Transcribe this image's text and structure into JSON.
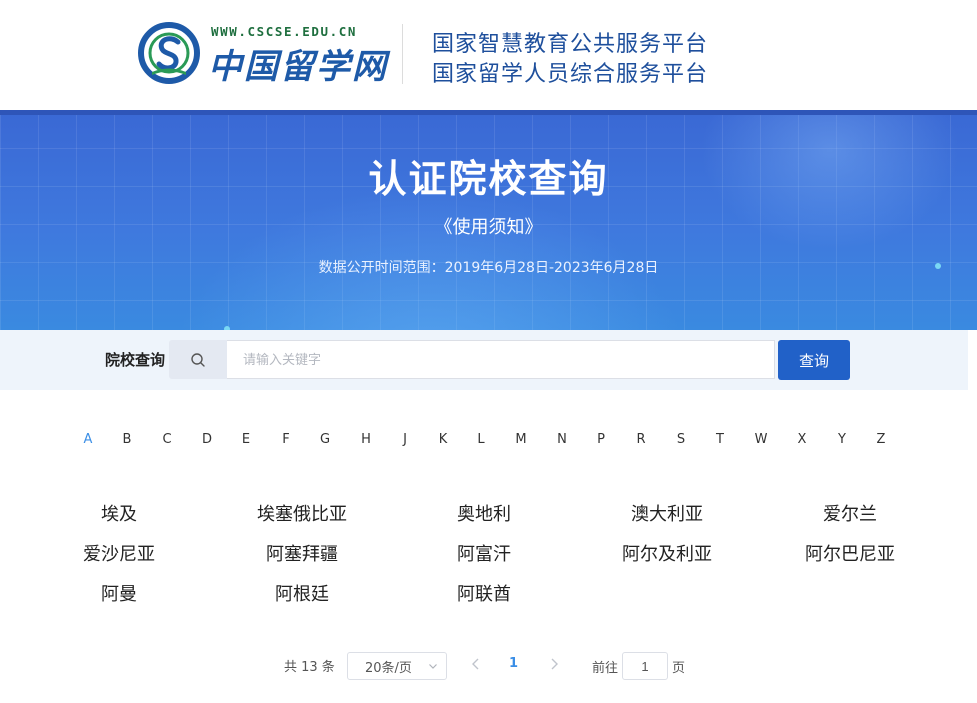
{
  "header": {
    "logo_url": "WWW.CSCSE.EDU.CN",
    "logo_name": "中国留学网",
    "platform_line_1": "国家智慧教育公共服务平台",
    "platform_line_2": "国家留学人员综合服务平台"
  },
  "banner": {
    "title": "认证院校查询",
    "notice_link": "《使用须知》",
    "range": "数据公开时间范围：2019年6月28日-2023年6月28日"
  },
  "search": {
    "label": "院校查询",
    "placeholder": "请输入关键字",
    "value": "",
    "button_label": "查询"
  },
  "letters": {
    "active": "A",
    "items": [
      "A",
      "B",
      "C",
      "D",
      "E",
      "F",
      "G",
      "H",
      "J",
      "K",
      "L",
      "M",
      "N",
      "P",
      "R",
      "S",
      "T",
      "W",
      "X",
      "Y",
      "Z"
    ]
  },
  "countries": [
    "埃及",
    "埃塞俄比亚",
    "奥地利",
    "澳大利亚",
    "爱尔兰",
    "爱沙尼亚",
    "阿塞拜疆",
    "阿富汗",
    "阿尔及利亚",
    "阿尔巴尼亚",
    "阿曼",
    "阿根廷",
    "阿联酋"
  ],
  "pagination": {
    "total": "共 13 条",
    "page_size": "20条/页",
    "current_page": "1",
    "goto_label": "前往",
    "goto_value": "1",
    "page_suffix": "页"
  },
  "colors": {
    "brand_blue": "#2161c8",
    "active_letter": "#3a8ee6",
    "logo_green": "#1f6f3f",
    "logo_blue": "#1e5aa8"
  }
}
